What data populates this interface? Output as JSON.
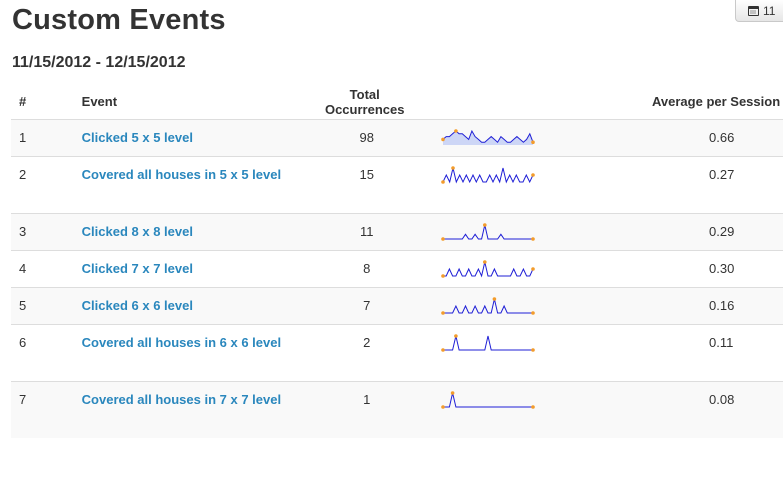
{
  "page": {
    "title": "Custom Events",
    "date_range": "11/15/2012 - 12/15/2012",
    "date_button_label": "11"
  },
  "colors": {
    "link": "#2a87bd",
    "spark_line": "#1f1fd6",
    "spark_fill": "#cdd6f6",
    "spark_dot": "#f39c2b"
  },
  "table": {
    "headers": [
      "#",
      "Event",
      "Total Occurrences",
      "",
      "Average per Session"
    ],
    "rows": [
      {
        "num": "1",
        "event": "Clicked 5 x 5 level",
        "total": "98",
        "avg": "0.66",
        "spark": [
          2,
          3,
          3,
          4,
          5,
          4,
          4,
          3,
          2,
          5,
          3,
          2,
          1,
          1,
          2,
          3,
          2,
          1,
          3,
          2,
          1,
          1,
          2,
          3,
          2,
          1,
          2,
          4,
          1
        ]
      },
      {
        "num": "2",
        "event": "Covered all houses in 5 x 5 level",
        "total": "15",
        "avg": "0.27",
        "spark": [
          0,
          1,
          0,
          2,
          0,
          1,
          0,
          1,
          0,
          1,
          0,
          1,
          0,
          0,
          1,
          0,
          1,
          0,
          2,
          0,
          1,
          0,
          1,
          0,
          0,
          1,
          0,
          1
        ]
      },
      {
        "num": "3",
        "event": "Clicked 8 x 8 level",
        "total": "11",
        "avg": "0.29",
        "spark": [
          0,
          0,
          0,
          0,
          0,
          0,
          0,
          1,
          0,
          0,
          1,
          0,
          0,
          3,
          0,
          0,
          0,
          0,
          1,
          0,
          0,
          0,
          0,
          0,
          0,
          0,
          0,
          0,
          0
        ]
      },
      {
        "num": "4",
        "event": "Clicked 7 x 7 level",
        "total": "8",
        "avg": "0.30",
        "spark": [
          0,
          0,
          1,
          0,
          0,
          1,
          0,
          0,
          1,
          0,
          0,
          1,
          0,
          2,
          0,
          0,
          1,
          0,
          0,
          0,
          0,
          0,
          1,
          0,
          0,
          1,
          0,
          0,
          1
        ]
      },
      {
        "num": "5",
        "event": "Clicked 6 x 6 level",
        "total": "7",
        "avg": "0.16",
        "spark": [
          0,
          0,
          0,
          0,
          1,
          0,
          0,
          1,
          0,
          0,
          1,
          0,
          0,
          1,
          0,
          0,
          2,
          0,
          0,
          1,
          0,
          0,
          0,
          0,
          0,
          0,
          0,
          0,
          0
        ]
      },
      {
        "num": "6",
        "event": "Covered all houses in 6 x 6 level",
        "total": "2",
        "avg": "0.11",
        "spark": [
          0,
          0,
          0,
          0,
          1,
          0,
          0,
          0,
          0,
          0,
          0,
          0,
          0,
          0,
          1,
          0,
          0,
          0,
          0,
          0,
          0,
          0,
          0,
          0,
          0,
          0,
          0,
          0,
          0
        ]
      },
      {
        "num": "7",
        "event": "Covered all houses in 7 x 7 level",
        "total": "1",
        "avg": "0.08",
        "spark": [
          0,
          0,
          0,
          1,
          0,
          0,
          0,
          0,
          0,
          0,
          0,
          0,
          0,
          0,
          0,
          0,
          0,
          0,
          0,
          0,
          0,
          0,
          0,
          0,
          0,
          0,
          0,
          0,
          0
        ]
      }
    ]
  }
}
